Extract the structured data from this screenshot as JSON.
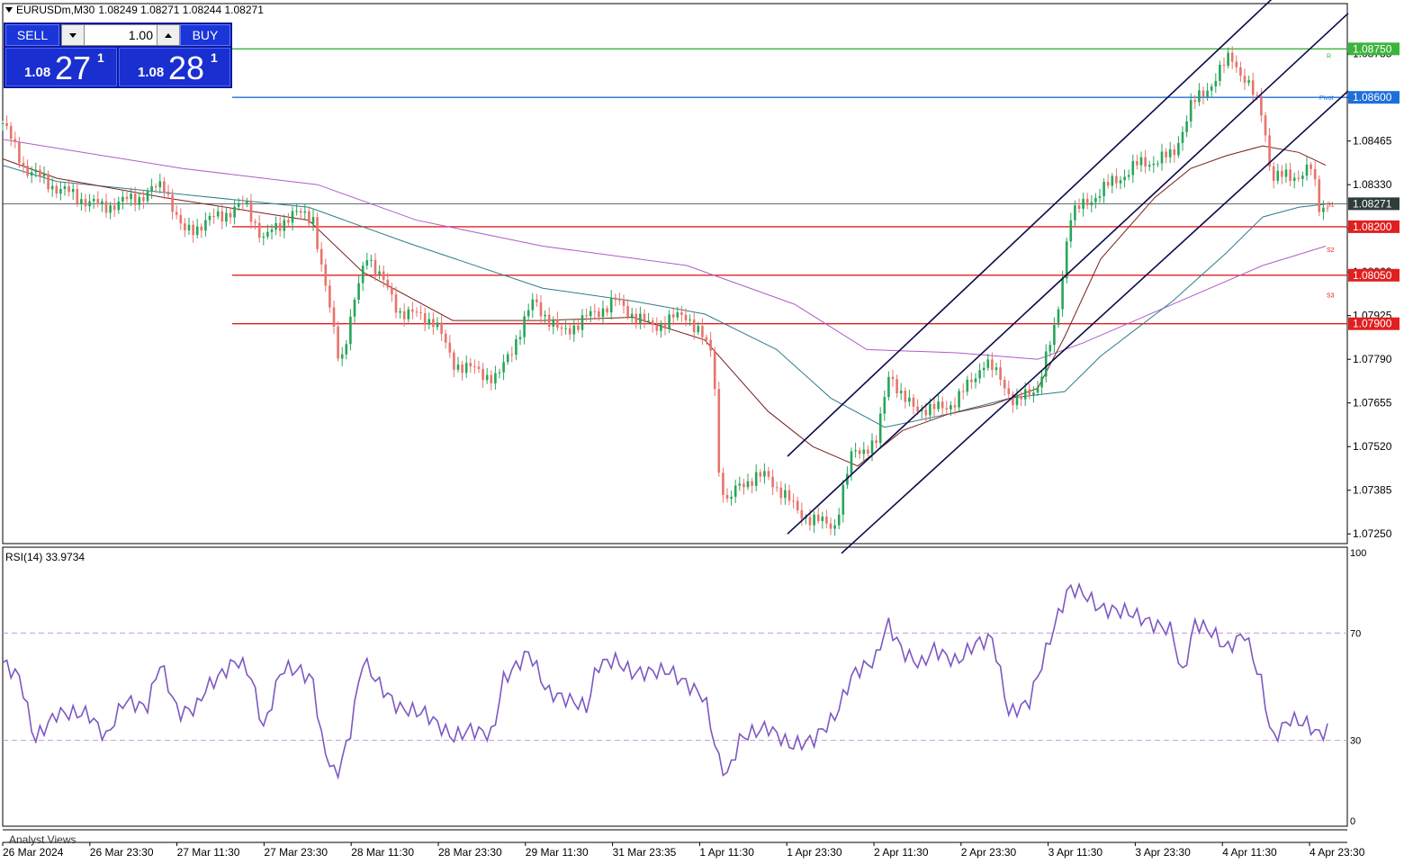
{
  "header": {
    "symbol": "EURUSDm,M30",
    "ohlc": "1.08249 1.08271 1.08244 1.08271"
  },
  "trade_panel": {
    "sell_label": "SELL",
    "buy_label": "BUY",
    "lot": "1.00",
    "sell": {
      "prefix": "1.08",
      "big": "27",
      "sup": "1"
    },
    "buy": {
      "prefix": "1.08",
      "big": "28",
      "sup": "1"
    }
  },
  "price_axis": {
    "ticks": [
      "1.08735",
      "1.08600",
      "1.08465",
      "1.08330",
      "1.08195",
      "1.08060",
      "1.07925",
      "1.07790",
      "1.07655",
      "1.07520",
      "1.07385",
      "1.07250"
    ]
  },
  "levels": [
    {
      "label": "1.08750",
      "value": 1.0875,
      "color": "#3cb43c",
      "tag": "R"
    },
    {
      "label": "1.08600",
      "value": 1.086,
      "color": "#1e6fd9",
      "tag": "Pivot"
    },
    {
      "label": "1.08271",
      "value": 1.08271,
      "color": "#2f3c3c",
      "tag": "S1",
      "is_current": true
    },
    {
      "label": "1.08200",
      "value": 1.082,
      "color": "#e02020",
      "tag": ""
    },
    {
      "label": "1.08050",
      "value": 1.0805,
      "color": "#e02020",
      "tag": "S2"
    },
    {
      "label": "1.07900",
      "value": 1.079,
      "color": "#e02020",
      "tag": "S3"
    }
  ],
  "rsi": {
    "label": "RSI(14) 33.9734",
    "ticks": [
      "100",
      "70",
      "30",
      "0"
    ],
    "levels": [
      70,
      30
    ]
  },
  "time_axis": {
    "labels": [
      "26 Mar 2024",
      "26 Mar 23:30",
      "27 Mar 11:30",
      "27 Mar 23:30",
      "28 Mar 11:30",
      "28 Mar 23:30",
      "29 Mar 11:30",
      "31 Mar 23:35",
      "1 Apr 11:30",
      "1 Apr 23:30",
      "2 Apr 11:30",
      "2 Apr 23:30",
      "3 Apr 11:30",
      "3 Apr 23:30",
      "4 Apr 11:30",
      "4 Apr 23:30"
    ]
  },
  "bottom_panel": {
    "label": "Analyst Views"
  },
  "colors": {
    "bull": "#26a65b",
    "bear": "#e8736b",
    "rsi": "#7e57c2",
    "ma_fast": "#7b1f1f",
    "ma_mid": "#2e7d8c",
    "ma_slow": "#b05cc8",
    "channel": "#0b0b4a"
  },
  "chart_data": {
    "type": "candlestick",
    "price_path": [
      [
        0,
        1.0852
      ],
      [
        25,
        1.0838
      ],
      [
        60,
        1.0832
      ],
      [
        110,
        1.0826
      ],
      [
        150,
        1.0829
      ],
      [
        180,
        1.0833
      ],
      [
        200,
        1.0818
      ],
      [
        230,
        1.0822
      ],
      [
        270,
        1.0827
      ],
      [
        290,
        1.0816
      ],
      [
        320,
        1.0824
      ],
      [
        345,
        1.0823
      ],
      [
        355,
        1.0806
      ],
      [
        375,
        1.0778
      ],
      [
        395,
        1.0801
      ],
      [
        405,
        1.0812
      ],
      [
        440,
        1.0794
      ],
      [
        480,
        1.0791
      ],
      [
        500,
        1.0778
      ],
      [
        550,
        1.0773
      ],
      [
        570,
        1.0785
      ],
      [
        590,
        1.0797
      ],
      [
        620,
        1.0787
      ],
      [
        650,
        1.0792
      ],
      [
        680,
        1.0797
      ],
      [
        720,
        1.0789
      ],
      [
        760,
        1.0793
      ],
      [
        790,
        1.078
      ],
      [
        795,
        1.0745
      ],
      [
        805,
        1.0734
      ],
      [
        820,
        1.0741
      ],
      [
        850,
        1.0743
      ],
      [
        880,
        1.0733
      ],
      [
        900,
        1.0729
      ],
      [
        925,
        1.0728
      ],
      [
        945,
        1.0751
      ],
      [
        970,
        1.0752
      ],
      [
        985,
        1.0776
      ],
      [
        1000,
        1.0766
      ],
      [
        1030,
        1.0763
      ],
      [
        1060,
        1.0766
      ],
      [
        1090,
        1.0778
      ],
      [
        1110,
        1.0773
      ],
      [
        1125,
        1.0765
      ],
      [
        1150,
        1.0771
      ],
      [
        1170,
        1.0789
      ],
      [
        1178,
        1.0806
      ],
      [
        1185,
        1.0823
      ],
      [
        1220,
        1.0831
      ],
      [
        1260,
        1.0839
      ],
      [
        1300,
        1.0842
      ],
      [
        1320,
        1.0857
      ],
      [
        1345,
        1.0865
      ],
      [
        1365,
        1.0873
      ],
      [
        1385,
        1.0863
      ],
      [
        1400,
        1.0855
      ],
      [
        1410,
        1.0835
      ],
      [
        1440,
        1.0836
      ],
      [
        1455,
        1.0838
      ],
      [
        1462,
        1.0826
      ],
      [
        1472,
        1.0827
      ]
    ],
    "rsi_path": [
      [
        0,
        59
      ],
      [
        20,
        53
      ],
      [
        35,
        30
      ],
      [
        60,
        40
      ],
      [
        95,
        40
      ],
      [
        115,
        31
      ],
      [
        135,
        45
      ],
      [
        160,
        42
      ],
      [
        175,
        59
      ],
      [
        195,
        40
      ],
      [
        215,
        42
      ],
      [
        225,
        49
      ],
      [
        260,
        60
      ],
      [
        275,
        55
      ],
      [
        290,
        34
      ],
      [
        310,
        57
      ],
      [
        330,
        56
      ],
      [
        345,
        52
      ],
      [
        355,
        29
      ],
      [
        370,
        16
      ],
      [
        385,
        31
      ],
      [
        400,
        60
      ],
      [
        420,
        50
      ],
      [
        440,
        42
      ],
      [
        470,
        40
      ],
      [
        500,
        31
      ],
      [
        520,
        34
      ],
      [
        545,
        32
      ],
      [
        555,
        52
      ],
      [
        585,
        63
      ],
      [
        605,
        48
      ],
      [
        630,
        45
      ],
      [
        650,
        42
      ],
      [
        660,
        58
      ],
      [
        680,
        60
      ],
      [
        700,
        55
      ],
      [
        740,
        56
      ],
      [
        760,
        51
      ],
      [
        780,
        46
      ],
      [
        795,
        23
      ],
      [
        805,
        17
      ],
      [
        820,
        31
      ],
      [
        850,
        35
      ],
      [
        875,
        28
      ],
      [
        900,
        30
      ],
      [
        925,
        39
      ],
      [
        945,
        55
      ],
      [
        970,
        60
      ],
      [
        983,
        74
      ],
      [
        1000,
        63
      ],
      [
        1020,
        58
      ],
      [
        1035,
        64
      ],
      [
        1060,
        59
      ],
      [
        1080,
        66
      ],
      [
        1100,
        68
      ],
      [
        1118,
        40
      ],
      [
        1140,
        44
      ],
      [
        1158,
        62
      ],
      [
        1170,
        74
      ],
      [
        1185,
        87
      ],
      [
        1200,
        85
      ],
      [
        1220,
        79
      ],
      [
        1250,
        78
      ],
      [
        1280,
        73
      ],
      [
        1300,
        71
      ],
      [
        1310,
        53
      ],
      [
        1325,
        74
      ],
      [
        1345,
        70
      ],
      [
        1360,
        64
      ],
      [
        1380,
        70
      ],
      [
        1400,
        50
      ],
      [
        1410,
        30
      ],
      [
        1430,
        38
      ],
      [
        1450,
        36
      ],
      [
        1462,
        32
      ],
      [
        1472,
        34
      ]
    ],
    "rsi_last": 33.9734,
    "ma_fast": [
      [
        0,
        1.0841
      ],
      [
        60,
        1.0835
      ],
      [
        180,
        1.0829
      ],
      [
        340,
        1.0822
      ],
      [
        400,
        1.0806
      ],
      [
        500,
        1.0791
      ],
      [
        600,
        1.0791
      ],
      [
        700,
        1.0792
      ],
      [
        780,
        1.0785
      ],
      [
        850,
        1.0763
      ],
      [
        900,
        1.0752
      ],
      [
        950,
        1.0746
      ],
      [
        1000,
        1.0757
      ],
      [
        1050,
        1.0762
      ],
      [
        1100,
        1.0765
      ],
      [
        1150,
        1.077
      ],
      [
        1180,
        1.0786
      ],
      [
        1220,
        1.081
      ],
      [
        1280,
        1.0829
      ],
      [
        1320,
        1.0838
      ],
      [
        1360,
        1.0842
      ],
      [
        1400,
        1.0845
      ],
      [
        1440,
        1.0843
      ],
      [
        1470,
        1.0839
      ]
    ],
    "ma_mid": [
      [
        0,
        1.0839
      ],
      [
        60,
        1.0834
      ],
      [
        200,
        1.083
      ],
      [
        340,
        1.0826
      ],
      [
        450,
        1.0815
      ],
      [
        600,
        1.0801
      ],
      [
        700,
        1.0797
      ],
      [
        780,
        1.0793
      ],
      [
        860,
        1.0782
      ],
      [
        920,
        1.0767
      ],
      [
        980,
        1.0758
      ],
      [
        1050,
        1.0762
      ],
      [
        1120,
        1.0767
      ],
      [
        1180,
        1.0769
      ],
      [
        1220,
        1.078
      ],
      [
        1300,
        1.0797
      ],
      [
        1360,
        1.0812
      ],
      [
        1400,
        1.0823
      ],
      [
        1440,
        1.0826
      ],
      [
        1470,
        1.0827
      ]
    ],
    "ma_slow": [
      [
        0,
        1.0847
      ],
      [
        200,
        1.0838
      ],
      [
        350,
        1.0833
      ],
      [
        460,
        1.0822
      ],
      [
        600,
        1.0814
      ],
      [
        760,
        1.0808
      ],
      [
        880,
        1.0796
      ],
      [
        960,
        1.0782
      ],
      [
        1060,
        1.0781
      ],
      [
        1150,
        1.0779
      ],
      [
        1200,
        1.0784
      ],
      [
        1300,
        1.0796
      ],
      [
        1400,
        1.0808
      ],
      [
        1470,
        1.0814
      ]
    ],
    "channels": [
      {
        "x1": 872,
        "y1": 1.0749,
        "x2": 1420,
        "y2": 1.0893
      },
      {
        "x1": 872,
        "y1": 1.0725,
        "x2": 1495,
        "y2": 1.0886
      },
      {
        "x1": 932,
        "y1": 1.0719,
        "x2": 1495,
        "y2": 1.0862
      }
    ],
    "series": [
      {
        "name": "RSI(14)"
      }
    ],
    "ylim": [
      1.0722,
      1.0889
    ],
    "rsi_ylim": [
      0,
      100
    ]
  }
}
